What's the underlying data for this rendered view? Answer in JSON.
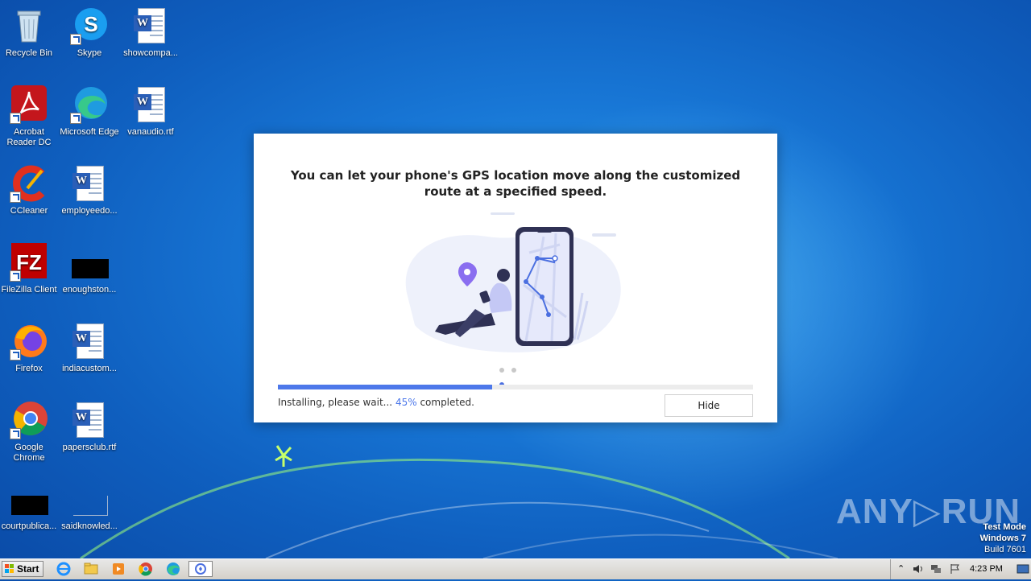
{
  "desktop": {
    "icons": [
      {
        "label": "Recycle Bin",
        "icon": "recycle-bin-icon"
      },
      {
        "label": "Skype",
        "icon": "skype-icon"
      },
      {
        "label": "showcompa...",
        "icon": "word-document-icon"
      },
      {
        "label": "Acrobat Reader DC",
        "icon": "acrobat-icon"
      },
      {
        "label": "Microsoft Edge",
        "icon": "edge-icon"
      },
      {
        "label": "vanaudio.rtf",
        "icon": "word-document-icon"
      },
      {
        "label": "CCleaner",
        "icon": "ccleaner-icon"
      },
      {
        "label": "employeedo...",
        "icon": "word-document-icon"
      },
      {
        "label": "FileZilla Client",
        "icon": "filezilla-icon"
      },
      {
        "label": "enoughston...",
        "icon": "black-thumbnail-icon"
      },
      {
        "label": "Firefox",
        "icon": "firefox-icon"
      },
      {
        "label": "indiacustom...",
        "icon": "word-document-icon"
      },
      {
        "label": "Google Chrome",
        "icon": "chrome-icon"
      },
      {
        "label": "papersclub.rtf",
        "icon": "word-document-icon"
      },
      {
        "label": "courtpublica...",
        "icon": "black-thumbnail-icon"
      },
      {
        "label": "saidknowled...",
        "icon": "blank-thumbnail-icon"
      }
    ]
  },
  "dialog": {
    "headline": "You can let your phone's GPS location move along the customized route at a specified speed.",
    "slide_index": 3,
    "slide_count": 3,
    "progress_fraction": 0.45,
    "status_prefix": "Installing, please wait...",
    "status_pct": "45%",
    "status_suffix": "completed.",
    "hide_label": "Hide",
    "accent_color": "#4d78ea"
  },
  "watermark": {
    "text": "ANY▷RUN"
  },
  "system": {
    "test_mode": "Test Mode",
    "os_name": "Windows 7",
    "build": "Build 7601"
  },
  "taskbar": {
    "start_label": "Start",
    "apps": [
      "ie-icon",
      "explorer-icon",
      "media-player-icon",
      "chrome-icon",
      "edge-icon",
      "installer-icon"
    ],
    "clock": "4:23 PM"
  }
}
